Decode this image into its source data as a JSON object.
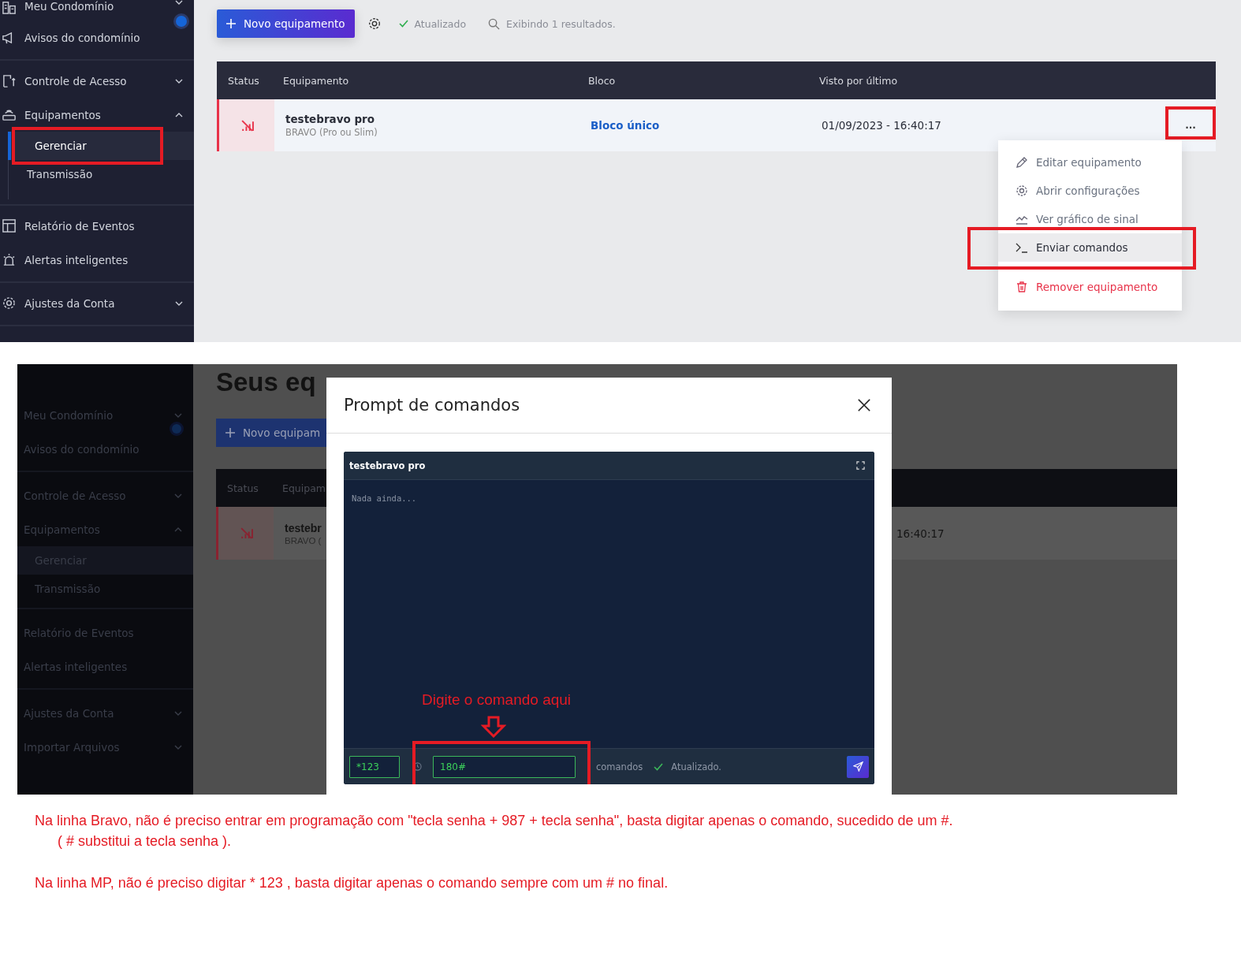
{
  "manage_view": {
    "sidebar": {
      "groups": [
        {
          "items": [
            {
              "label": "Meu Condomínio",
              "expanded": false,
              "has_notification": true
            },
            {
              "label": "Avisos do condomínio"
            }
          ]
        },
        {
          "items": [
            {
              "label": "Controle de Acesso",
              "expanded": false
            },
            {
              "label": "Equipamentos",
              "expanded": true,
              "children": [
                {
                  "label": "Gerenciar",
                  "selected": true,
                  "annotated": true
                },
                {
                  "label": "Transmissão",
                  "selected": false,
                  "annotated": false
                }
              ]
            }
          ]
        },
        {
          "items": [
            {
              "label": "Relatório de Eventos"
            },
            {
              "label": "Alertas inteligentes"
            }
          ]
        },
        {
          "items": [
            {
              "label": "Ajustes da Conta",
              "expanded": false
            }
          ]
        }
      ]
    },
    "toolbar": {
      "new_button": "Novo equipamento",
      "status": "Atualizado",
      "results": "Exibindo 1 resultados."
    },
    "table": {
      "columns": [
        "Status",
        "Equipamento",
        "Bloco",
        "Visto por último"
      ],
      "rows": [
        {
          "online": false,
          "name": "testebravo pro",
          "model": "BRAVO (Pro ou Slim)",
          "block": "Bloco único",
          "last_seen": "01/09/2023 - 16:40:17",
          "more": "...",
          "more_annotated": true
        }
      ]
    },
    "menu": {
      "items": [
        {
          "kind": "edit",
          "label": "Editar equipamento",
          "selected": false,
          "annotated": false
        },
        {
          "kind": "settings",
          "label": "Abrir configurações",
          "selected": false,
          "annotated": false
        },
        {
          "kind": "chart",
          "label": "Ver gráfico de sinal",
          "selected": false,
          "annotated": false
        },
        {
          "kind": "terminal",
          "label": "Enviar comandos",
          "selected": true,
          "annotated": true
        },
        {
          "kind": "danger",
          "label": "Remover equipamento",
          "selected": false,
          "annotated": false
        }
      ]
    }
  },
  "prompt_view": {
    "background": {
      "sidebar": [
        {
          "label": "Meu Condomínio",
          "expanded": false
        },
        {
          "label": "Avisos do condomínio",
          "divider_after": true
        },
        {
          "label": "Controle de Acesso",
          "expanded": false
        },
        {
          "label": "Equipamentos",
          "expanded": true
        },
        {
          "label": "Gerenciar",
          "sub": true,
          "selected": true
        },
        {
          "label": "Transmissão",
          "sub": true,
          "selected": false,
          "divider_after": true
        },
        {
          "label": "Relatório de Eventos"
        },
        {
          "label": "Alertas inteligentes",
          "divider_after": true
        },
        {
          "label": "Ajustes da Conta",
          "expanded": false
        },
        {
          "label": "Importar Arquivos",
          "expanded": false
        }
      ],
      "heading": "Seus eq",
      "new_button": "Novo equipam",
      "columns": [
        "Status",
        "Equipam"
      ],
      "row": {
        "online": false,
        "name": "testebr",
        "model": "BRAVO (",
        "last_seen": "16:40:17"
      }
    },
    "modal": {
      "title": "Prompt de comandos",
      "terminal": {
        "title": "testebravo pro",
        "output": "Nada ainda...",
        "prefix_value": "*123",
        "command_value": "180#",
        "command_annotated": true,
        "status": "comandos",
        "updated": "Atualizado."
      },
      "annotation": "Digite o comando aqui"
    }
  },
  "notes": [
    {
      "lines": [
        "Na linha Bravo, não é preciso entrar em programação com \"tecla senha + 987 + tecla senha\", basta digitar apenas o comando, sucedido de um #.",
        "( # substitui a tecla senha )."
      ]
    },
    {
      "lines": [
        "Na linha MP, não é preciso digitar * 123 , basta digitar apenas o comando sempre com um # no final."
      ]
    }
  ]
}
